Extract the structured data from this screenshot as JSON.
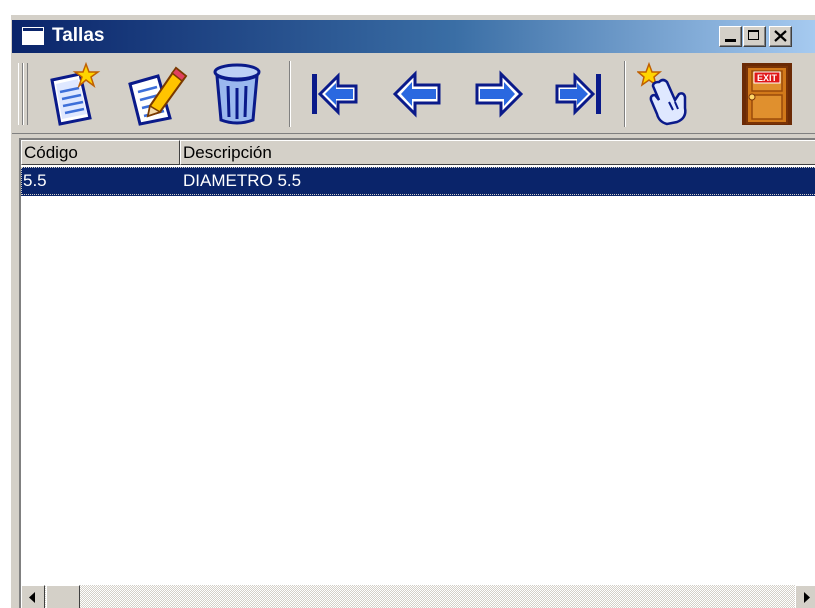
{
  "window": {
    "title": "Tallas"
  },
  "title_buttons": {
    "minimize": "minimize",
    "maximize": "maximize",
    "close": "close"
  },
  "toolbar": {
    "items": [
      {
        "name": "new-record-icon"
      },
      {
        "name": "edit-record-icon"
      },
      {
        "name": "trash-icon"
      },
      {
        "name": "first-record-icon"
      },
      {
        "name": "previous-record-icon"
      },
      {
        "name": "next-record-icon"
      },
      {
        "name": "last-record-icon"
      },
      {
        "name": "select-hand-icon"
      },
      {
        "name": "exit-door-icon",
        "label": "EXIT"
      }
    ]
  },
  "table": {
    "columns": [
      "Código",
      "Descripción"
    ],
    "rows": [
      {
        "code": "5.5",
        "description": "DIAMETRO 5.5",
        "selected": true
      }
    ]
  },
  "colors": {
    "selection": "#0a246a",
    "face": "#d4d0c8",
    "arrow": "#1e4fd8",
    "icon_outline": "#0a1a8a"
  }
}
